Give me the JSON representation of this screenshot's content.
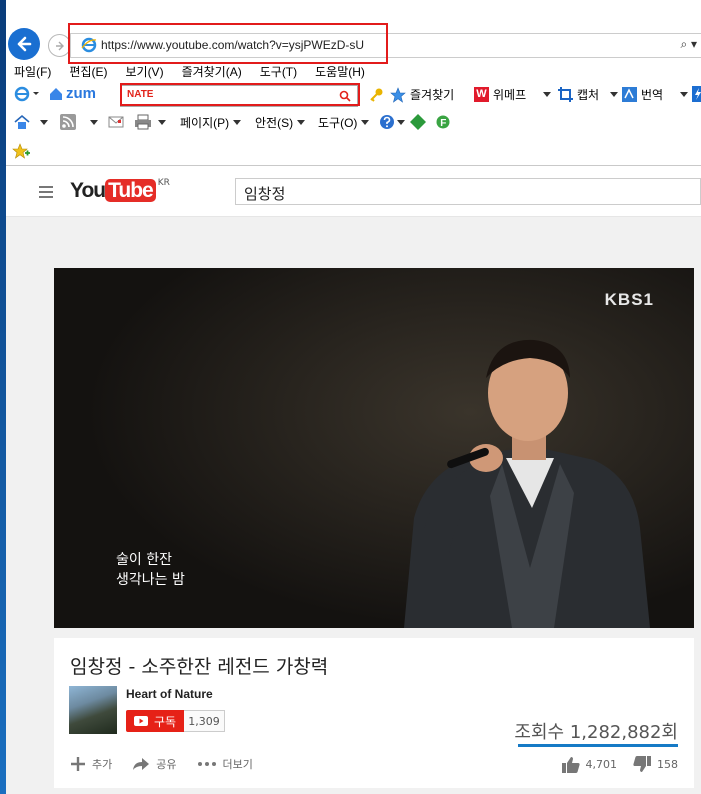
{
  "browser": {
    "url": "https://www.youtube.com/watch?v=ysjPWEzD-sU",
    "search_glyph": "⌕ ▾",
    "menu": [
      "파일(F)",
      "편집(E)",
      "보기(V)",
      "즐겨찾기(A)",
      "도구(T)",
      "도움말(H)"
    ],
    "toolbar1": {
      "zum": "zum",
      "nate": "NATE",
      "favorites": "즐겨찾기",
      "wemakeprice": "위메프",
      "capture": "캡처",
      "translate": "번역"
    },
    "toolbar2": {
      "page": "페이지(P)",
      "safety": "안전(S)",
      "tools": "도구(O)"
    }
  },
  "youtube": {
    "logo_you": "You",
    "logo_tube": "Tube",
    "logo_region": "KR",
    "search_value": "임창정"
  },
  "video": {
    "watermark": "KBS1",
    "subtitle_line1": "술이 한잔",
    "subtitle_line2": "생각나는 밤",
    "title": "임창정 - 소주한잔 레전드 가창력",
    "channel": "Heart of Nature",
    "subscribe_label": "구독",
    "subscriber_count": "1,309",
    "views": "조회수 1,282,882회",
    "add_label": "추가",
    "share_label": "공유",
    "more_label": "더보기",
    "likes": "4,701",
    "dislikes": "158"
  },
  "colors": {
    "accent_red": "#e62117",
    "highlight_box": "#e21b1b",
    "ie_blue": "#1a6fd1"
  }
}
